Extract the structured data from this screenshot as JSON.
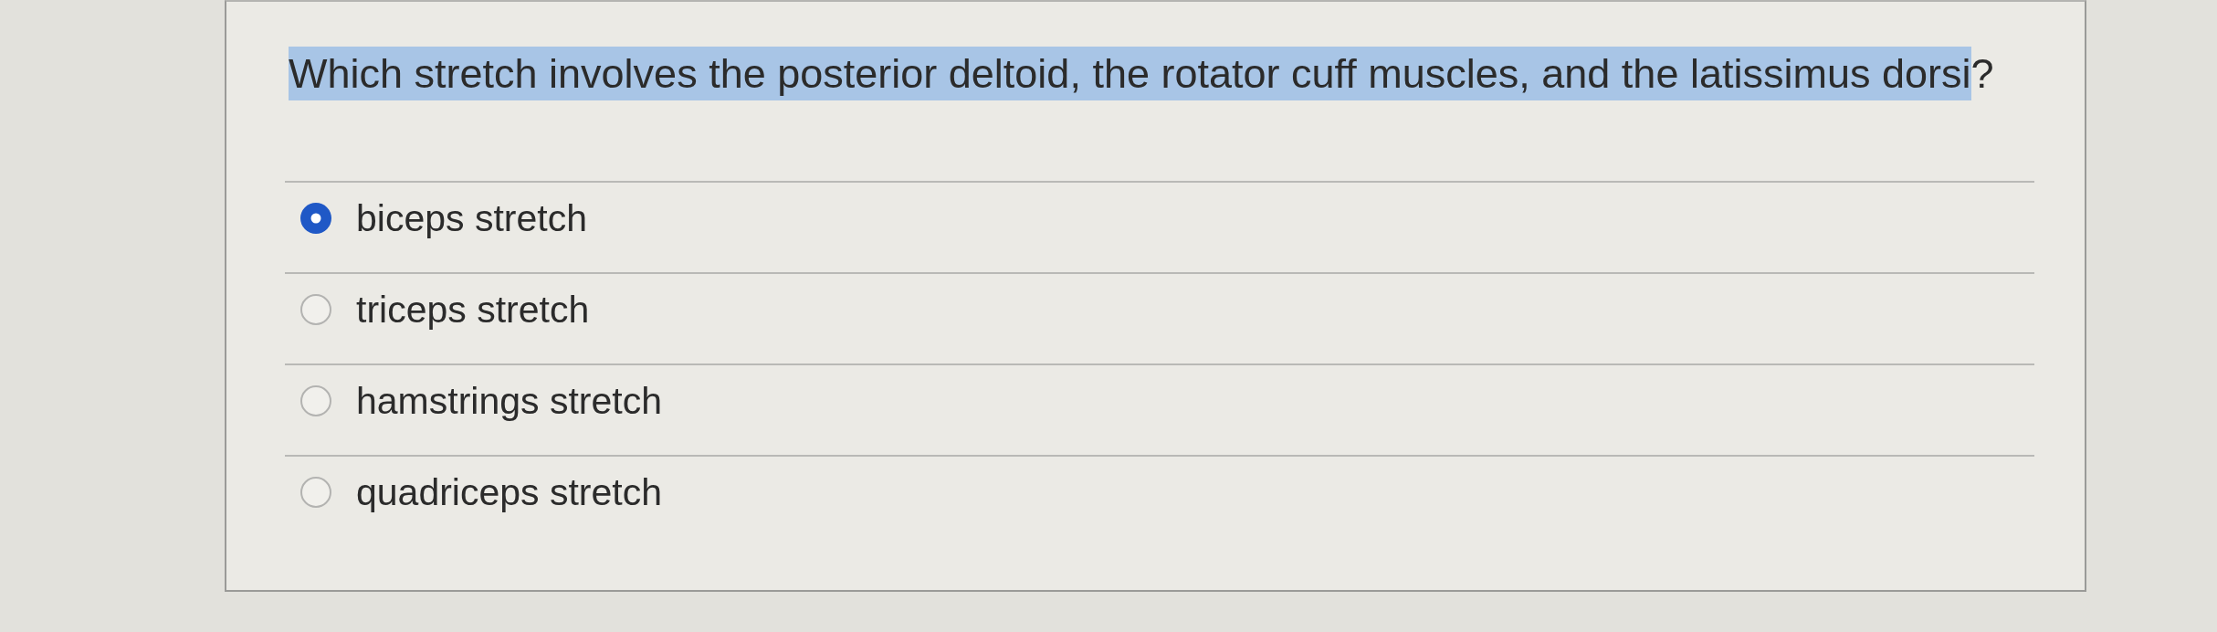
{
  "question": {
    "parts": [
      {
        "text": "Which stretch involves the posterior deltoid, the rotator cuff muscles, and the latissimus dorsi",
        "highlighted": true
      },
      {
        "text": "?",
        "highlighted": false
      }
    ]
  },
  "options": [
    {
      "label": "biceps stretch",
      "selected": true
    },
    {
      "label": "triceps stretch",
      "selected": false
    },
    {
      "label": "hamstrings stretch",
      "selected": false
    },
    {
      "label": "quadriceps stretch",
      "selected": false
    }
  ]
}
